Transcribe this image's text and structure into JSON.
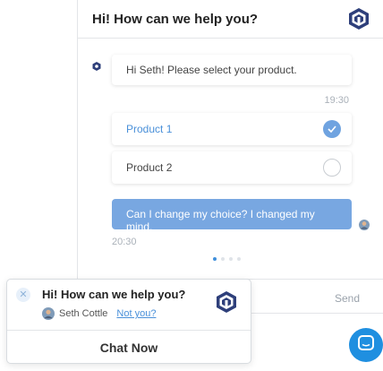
{
  "chat": {
    "header_title": "Hi! How can we help you?",
    "bot_message": "Hi Seth! Please select your product.",
    "bot_time": "19:30",
    "options": [
      {
        "label": "Product 1",
        "selected": true
      },
      {
        "label": "Product 2",
        "selected": false
      }
    ],
    "user_message": "Can I change my choice? I changed my mind.",
    "user_time": "20:30",
    "send_label": "Send",
    "carousel": {
      "count": 4,
      "active_index": 0
    }
  },
  "popup": {
    "title": "Hi! How can we help you?",
    "agent_name": "Seth Cottle",
    "not_you_label": "Not you?",
    "cta_label": "Chat Now"
  },
  "icons": {
    "close": "close-icon",
    "check": "check-icon",
    "brand_logo": "brand-logo-icon",
    "launcher": "chat-bubble-icon"
  },
  "colors": {
    "accent": "#4a90d9",
    "user_bubble": "#78a7e1",
    "brand_dark": "#2e3f7a",
    "launcher": "#1f8fe0"
  }
}
